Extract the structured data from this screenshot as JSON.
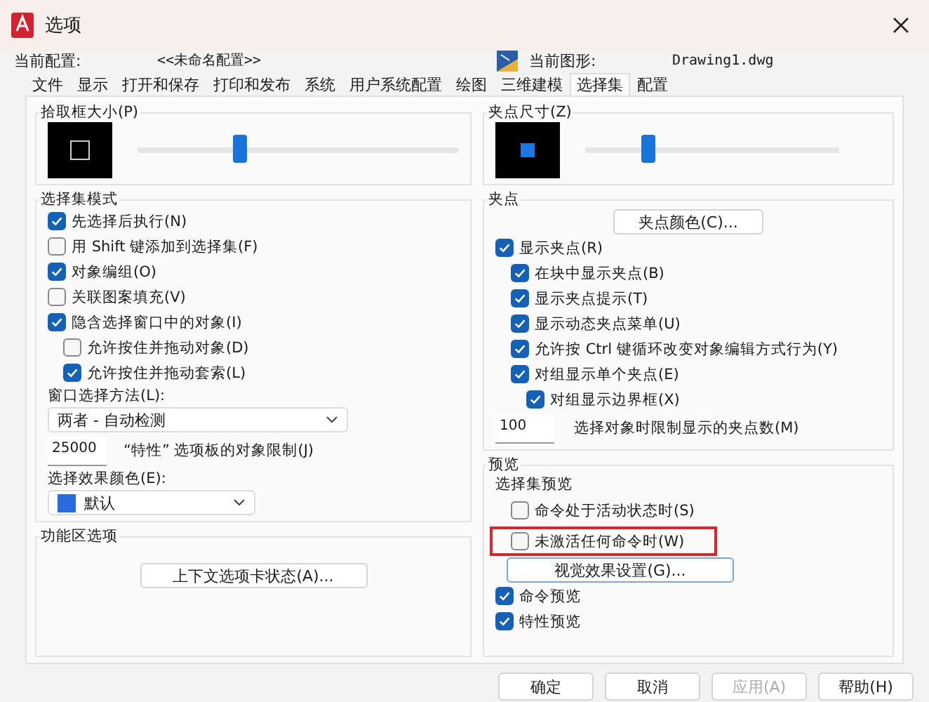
{
  "window": {
    "title": "选项"
  },
  "profile": {
    "label": "当前配置:",
    "value": "<<未命名配置>>"
  },
  "drawing": {
    "label": "当前图形:",
    "value": "Drawing1.dwg"
  },
  "tabs": [
    {
      "label": "文件",
      "selected": false
    },
    {
      "label": "显示",
      "selected": false
    },
    {
      "label": "打开和保存",
      "selected": false
    },
    {
      "label": "打印和发布",
      "selected": false
    },
    {
      "label": "系统",
      "selected": false
    },
    {
      "label": "用户系统配置",
      "selected": false
    },
    {
      "label": "绘图",
      "selected": false
    },
    {
      "label": "三维建模",
      "selected": false
    },
    {
      "label": "选择集",
      "selected": true
    },
    {
      "label": "配置",
      "selected": false
    }
  ],
  "pickbox": {
    "title": "拾取框大小(P)",
    "level": 0.32
  },
  "selection_modes": {
    "title": "选择集模式",
    "options": [
      {
        "label": "先选择后执行(N)",
        "checked": true
      },
      {
        "label": "用 Shift 键添加到选择集(F)",
        "checked": false
      },
      {
        "label": "对象编组(O)",
        "checked": true
      },
      {
        "label": "关联图案填充(V)",
        "checked": false
      },
      {
        "label": "隐含选择窗口中的对象(I)",
        "checked": true,
        "children": [
          {
            "label": "允许按住并拖动对象(D)",
            "checked": false
          },
          {
            "label": "允许按住并拖动套索(L)",
            "checked": true
          }
        ]
      }
    ],
    "window_method": {
      "label": "窗口选择方法(L):",
      "value": "两者 - 自动检测"
    },
    "object_limit": {
      "value": "25000",
      "label": "“特性” 选项板的对象限制(J)"
    },
    "effect_color": {
      "label": "选择效果颜色(E):",
      "value": "默认",
      "color": "#2b6be0"
    }
  },
  "ribbon": {
    "title": "功能区选项",
    "button": "上下文选项卡状态(A)..."
  },
  "grip_size": {
    "title": "夹点尺寸(Z)",
    "level": 0.25
  },
  "grips": {
    "title": "夹点",
    "button": "夹点颜色(C)...",
    "options": [
      {
        "label": "显示夹点(R)",
        "checked": true,
        "children": [
          {
            "label": "在块中显示夹点(B)",
            "checked": true
          },
          {
            "label": "显示夹点提示(T)",
            "checked": true
          },
          {
            "label": "显示动态夹点菜单(U)",
            "checked": true
          },
          {
            "label": "允许按 Ctrl 键循环改变对象编辑方式行为(Y)",
            "checked": true
          },
          {
            "label": "对组显示单个夹点(E)",
            "checked": true,
            "children": [
              {
                "label": "对组显示边界框(X)",
                "checked": true
              }
            ]
          }
        ]
      }
    ],
    "limit": {
      "value": "100",
      "label": "选择对象时限制显示的夹点数(M)"
    }
  },
  "preview": {
    "title": "预览",
    "subtitle": "选择集预览",
    "options": [
      {
        "label": "命令处于活动状态时(S)",
        "checked": false,
        "highlighted": false
      },
      {
        "label": "未激活任何命令时(W)",
        "checked": false,
        "highlighted": true
      }
    ],
    "button": "视觉效果设置(G)...",
    "more": [
      {
        "label": "命令预览",
        "checked": true
      },
      {
        "label": "特性预览",
        "checked": true
      }
    ]
  },
  "buttons": [
    {
      "label": "确定",
      "disabled": false
    },
    {
      "label": "取消",
      "disabled": false
    },
    {
      "label": "应用(A)",
      "disabled": true
    },
    {
      "label": "帮助(H)",
      "disabled": false
    }
  ]
}
